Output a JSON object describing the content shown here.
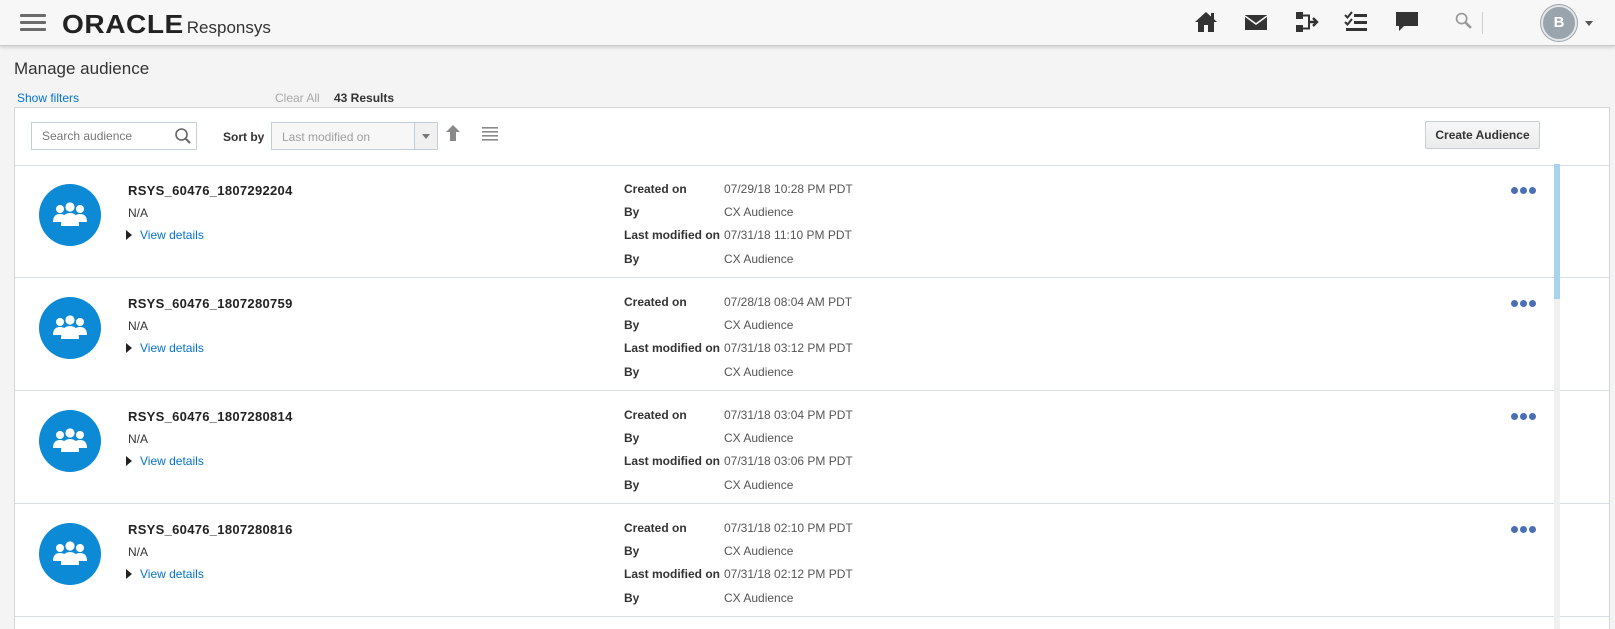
{
  "header": {
    "brand": "ORACLE",
    "product": "Responsys",
    "avatar_initial": "B",
    "icons": [
      "home-icon",
      "mail-icon",
      "program-icon",
      "tasks-icon",
      "chat-icon",
      "search-icon"
    ]
  },
  "page": {
    "title": "Manage audience",
    "show_filters": "Show filters",
    "clear_all": "Clear All",
    "results": "43 Results"
  },
  "toolbar": {
    "search_placeholder": "Search audience",
    "sort_label": "Sort by",
    "sort_value": "Last modified on",
    "create_label": "Create Audience"
  },
  "labels": {
    "created_on": "Created on",
    "by": "By",
    "last_modified_on": "Last modified on",
    "view_details": "View details"
  },
  "audiences": [
    {
      "name": "RSYS_60476_1807292204",
      "description": "N/A",
      "created_on": "07/29/18 10:28 PM PDT",
      "created_by": "CX Audience",
      "modified_on": "07/31/18 11:10 PM PDT",
      "modified_by": "CX Audience"
    },
    {
      "name": "RSYS_60476_1807280759",
      "description": "N/A",
      "created_on": "07/28/18 08:04 AM PDT",
      "created_by": "CX Audience",
      "modified_on": "07/31/18 03:12 PM PDT",
      "modified_by": "CX Audience"
    },
    {
      "name": "RSYS_60476_1807280814",
      "description": "N/A",
      "created_on": "07/31/18 03:04 PM PDT",
      "created_by": "CX Audience",
      "modified_on": "07/31/18 03:06 PM PDT",
      "modified_by": "CX Audience"
    },
    {
      "name": "RSYS_60476_1807280816",
      "description": "N/A",
      "created_on": "07/31/18 02:10 PM PDT",
      "created_by": "CX Audience",
      "modified_on": "07/31/18 02:12 PM PDT",
      "modified_by": "CX Audience"
    }
  ],
  "colors": {
    "accent": "#0572ce",
    "audience_icon_bg": "#0d8ad6",
    "more_dots": "#4a6fb5"
  }
}
